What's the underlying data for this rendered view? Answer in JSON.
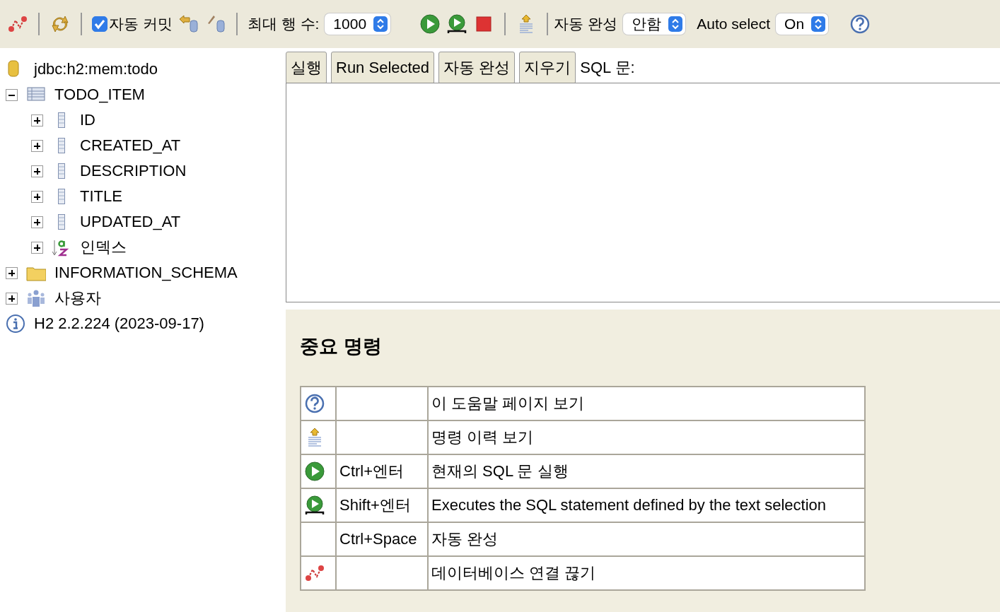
{
  "toolbar": {
    "auto_commit": {
      "label": "자동 커밋",
      "checked": true
    },
    "max_rows": {
      "label": "최대 행 수:",
      "value": "1000"
    },
    "auto_complete": {
      "label": "자동 완성",
      "value": "안함"
    },
    "auto_select": {
      "label": "Auto select",
      "value": "On"
    }
  },
  "tree": [
    {
      "kind": "database",
      "label": "jdbc:h2:mem:todo"
    },
    {
      "kind": "table",
      "label": "TODO_ITEM",
      "expanded": true,
      "children": [
        {
          "kind": "column",
          "label": "ID",
          "expanded": false
        },
        {
          "kind": "column",
          "label": "CREATED_AT",
          "expanded": false
        },
        {
          "kind": "column",
          "label": "DESCRIPTION",
          "expanded": false
        },
        {
          "kind": "column",
          "label": "TITLE",
          "expanded": false
        },
        {
          "kind": "column",
          "label": "UPDATED_AT",
          "expanded": false
        },
        {
          "kind": "index",
          "label": "인덱스",
          "expanded": false
        }
      ]
    },
    {
      "kind": "folder",
      "label": "INFORMATION_SCHEMA",
      "expanded": false
    },
    {
      "kind": "users",
      "label": "사용자",
      "expanded": false
    },
    {
      "kind": "info",
      "label": "H2 2.2.224 (2023-09-17)"
    }
  ],
  "buttons": [
    "실행",
    "Run Selected",
    "자동 완성",
    "지우기"
  ],
  "sql_label": "SQL 문:",
  "help": {
    "title": "중요 명령",
    "rows": [
      {
        "kind": "help",
        "description": "이 도움말 페이지 보기"
      },
      {
        "kind": "history",
        "description": "명령 이력 보기"
      },
      {
        "kind": "run",
        "shortcut": "Ctrl+엔터",
        "description": "현재의 SQL 문 실행"
      },
      {
        "kind": "run_selected",
        "shortcut": "Shift+엔터",
        "description": "Executes the SQL statement defined by the text selection"
      },
      {
        "kind": "autocomplete",
        "shortcut": "Ctrl+Space",
        "description": "자동 완성"
      },
      {
        "kind": "disconnect",
        "description": "데이터베이스 연결 끊기"
      }
    ]
  }
}
